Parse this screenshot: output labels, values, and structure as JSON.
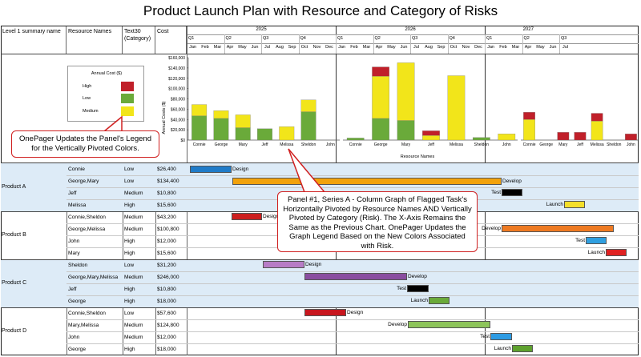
{
  "title": "Product Launch Plan with Resource and Category of Risks",
  "headers": {
    "col1": "Level 1 summary name",
    "col2": "Resource Names",
    "col3": "Text30 (Category)",
    "col4": "Cost"
  },
  "years": [
    "2025",
    "2026",
    "2027"
  ],
  "quarters": [
    "Q1",
    "Q2",
    "Q3",
    "Q4",
    "Q1",
    "Q2",
    "Q3",
    "Q4",
    "Q1",
    "Q2",
    "Q3"
  ],
  "months": [
    "Jan",
    "Feb",
    "Mar",
    "Apr",
    "May",
    "Jun",
    "Jul",
    "Aug",
    "Sep",
    "Oct",
    "Nov",
    "Dec",
    "Jan",
    "Feb",
    "Mar",
    "Apr",
    "May",
    "Jun",
    "Jul",
    "Aug",
    "Sep",
    "Oct",
    "Nov",
    "Dec",
    "Jan",
    "Feb",
    "Mar",
    "Apr",
    "May",
    "Jun",
    "Jul"
  ],
  "legend": {
    "title": "Annual Cost ($)",
    "items": [
      {
        "label": "High",
        "color": "#c0202a"
      },
      {
        "label": "Low",
        "color": "#6aaa3a"
      },
      {
        "label": "Medium",
        "color": "#f2e51a"
      }
    ]
  },
  "callouts": {
    "legend_note": "OnePager Updates the Panel's Legend for the Vertically Pivoted Colors.",
    "chart_note": "Panel #1, Series A - Column Graph of Flagged Task's Horizontally Pivoted by Resource Names AND Vertically Pivoted by Category (Risk). The X-Axis Remains the Same as the Previous Chart. OnePager Updates the Graph Legend Based on the New Colors Associated with Risk."
  },
  "chart_data": [
    {
      "type": "bar",
      "stacked": true,
      "ylabel": "Annual Costs ($)",
      "xlabel": "Resource Names",
      "ylim": [
        0,
        160000
      ],
      "yticks": [
        "$0",
        "$20,000",
        "$40,000",
        "$60,000",
        "$80,000",
        "$100,000",
        "$120,000",
        "$140,000",
        "$160,000"
      ],
      "categories": [
        "Connie",
        "George",
        "Mary",
        "Jeff",
        "Melissa",
        "Sheldon",
        "John"
      ],
      "series": [
        {
          "name": "Low",
          "color": "#6aaa3a",
          "values": [
            47000,
            42000,
            24000,
            22000,
            0,
            55000,
            0
          ]
        },
        {
          "name": "Medium",
          "color": "#f2e51a",
          "values": [
            22000,
            15000,
            25000,
            0,
            26000,
            23000,
            0
          ]
        },
        {
          "name": "High",
          "color": "#c0202a",
          "values": [
            0,
            0,
            0,
            0,
            0,
            0,
            0
          ]
        }
      ]
    },
    {
      "type": "bar",
      "stacked": true,
      "categories": [
        "Connie",
        "George",
        "Mary",
        "Jeff",
        "Melissa",
        "Sheldon",
        "John"
      ],
      "series": [
        {
          "name": "Low",
          "color": "#6aaa3a",
          "values": [
            4000,
            42000,
            38000,
            0,
            0,
            5000,
            0
          ]
        },
        {
          "name": "Medium",
          "color": "#f2e51a",
          "values": [
            0,
            82000,
            112000,
            9000,
            125000,
            0,
            12000
          ]
        },
        {
          "name": "High",
          "color": "#c0202a",
          "values": [
            0,
            18000,
            0,
            9000,
            0,
            0,
            0
          ]
        }
      ]
    },
    {
      "type": "bar",
      "stacked": true,
      "categories": [
        "Connie",
        "George",
        "Mary",
        "Jeff",
        "Melissa",
        "Sheldon",
        "John"
      ],
      "series": [
        {
          "name": "Low",
          "color": "#6aaa3a",
          "values": [
            0,
            0,
            0,
            0,
            0,
            0,
            0
          ]
        },
        {
          "name": "Medium",
          "color": "#f2e51a",
          "values": [
            40000,
            0,
            0,
            0,
            37000,
            0,
            0
          ]
        },
        {
          "name": "High",
          "color": "#c0202a",
          "values": [
            14000,
            0,
            15000,
            15000,
            15000,
            0,
            12000
          ]
        }
      ]
    }
  ],
  "groups": [
    {
      "name": "Product A",
      "rows": [
        {
          "resource": "Connie",
          "category": "Low",
          "cost": "$26,400"
        },
        {
          "resource": "George,Mary",
          "category": "Low",
          "cost": "$134,400"
        },
        {
          "resource": "Jeff",
          "category": "Medium",
          "cost": "$10,800"
        },
        {
          "resource": "Melissa",
          "category": "High",
          "cost": "$15,600"
        }
      ]
    },
    {
      "name": "Product B",
      "rows": [
        {
          "resource": "Connie,Sheldon",
          "category": "Medium",
          "cost": "$43,200"
        },
        {
          "resource": "George,Melissa",
          "category": "Medium",
          "cost": "$100,800"
        },
        {
          "resource": "John",
          "category": "High",
          "cost": "$12,000"
        },
        {
          "resource": "Mary",
          "category": "High",
          "cost": "$15,600"
        }
      ]
    },
    {
      "name": "Product C",
      "rows": [
        {
          "resource": "Sheldon",
          "category": "Low",
          "cost": "$31,200"
        },
        {
          "resource": "George,Mary,Melissa",
          "category": "Medium",
          "cost": "$246,000"
        },
        {
          "resource": "Jeff",
          "category": "High",
          "cost": "$10,800"
        },
        {
          "resource": "George",
          "category": "High",
          "cost": "$18,000"
        }
      ]
    },
    {
      "name": "Product D",
      "rows": [
        {
          "resource": "Connie,Sheldon",
          "category": "Low",
          "cost": "$57,600"
        },
        {
          "resource": "Mary,Melissa",
          "category": "Medium",
          "cost": "$124,800"
        },
        {
          "resource": "John",
          "category": "Medium",
          "cost": "$12,000"
        },
        {
          "resource": "George",
          "category": "High",
          "cost": "$18,000"
        }
      ]
    }
  ],
  "gantt_labels": {
    "design": "Design",
    "develop": "Develop",
    "test": "Test",
    "launch": "Launch"
  },
  "colors": {
    "band_blue": "#ddebf7",
    "blue": "#1f7bc8",
    "orange": "#f2a20c",
    "black": "#000000",
    "yellow": "#f4df2a",
    "red": "#cc1f1f",
    "orange2": "#ee7a22",
    "lightblue": "#2f9fe0",
    "darkred": "#e02222",
    "violet": "#b77cc6",
    "purple": "#8a4ea0",
    "green": "#6aaa3a",
    "crimson": "#c8161e",
    "lightgreen": "#8dc45a",
    "skyblue": "#2d9be3",
    "darkgreen": "#5ea12e"
  }
}
